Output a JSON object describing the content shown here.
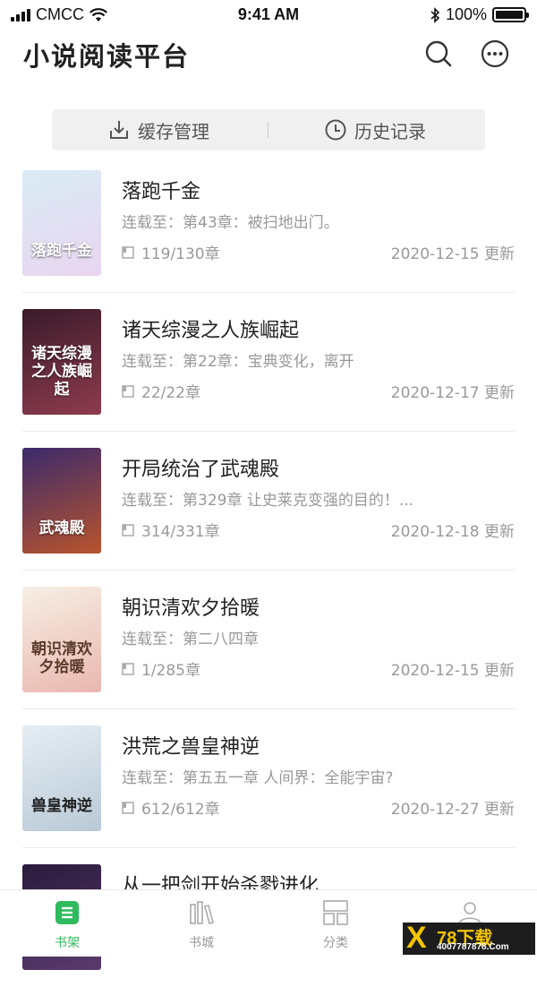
{
  "status_bar": {
    "carrier": "CMCC",
    "time": "9:41 AM",
    "battery": "100%"
  },
  "header": {
    "title": "小说阅读平台",
    "search_icon": "search-icon",
    "more_icon": "more-icon"
  },
  "tabs": {
    "cache": "缓存管理",
    "history": "历史记录"
  },
  "books": [
    {
      "title": "落跑千金",
      "progress": "连载至：第43章：被扫地出门。",
      "chapters": "119/130章",
      "updated": "2020-12-15 更新",
      "cover_text": "落跑千金",
      "cover_colors": [
        "#d9ecf5",
        "#e9d5f0"
      ]
    },
    {
      "title": "诸天综漫之人族崛起",
      "progress": "连载至：第22章：宝典变化，离开",
      "chapters": "22/22章",
      "updated": "2020-12-17 更新",
      "cover_text": "诸天综漫之人族崛起",
      "cover_colors": [
        "#3a1b2a",
        "#8e3b4e"
      ]
    },
    {
      "title": "开局统治了武魂殿",
      "progress": "连载至：第329章 让史莱克变强的目的！...",
      "chapters": "314/331章",
      "updated": "2020-12-18 更新",
      "cover_text": "武魂殿",
      "cover_colors": [
        "#3b2a6b",
        "#b9542d"
      ]
    },
    {
      "title": "朝识清欢夕拾暖",
      "progress": "连载至：第二八四章",
      "chapters": "1/285章",
      "updated": "2020-12-15 更新",
      "cover_text": "朝识清欢夕拾暖",
      "cover_colors": [
        "#f7efe4",
        "#e9b7b0"
      ]
    },
    {
      "title": "洪荒之兽皇神逆",
      "progress": "连载至：第五五一章 人间界：全能宇宙?",
      "chapters": "612/612章",
      "updated": "2020-12-27 更新",
      "cover_text": "兽皇神逆",
      "cover_colors": [
        "#e6eef4",
        "#b9c9d6"
      ]
    },
    {
      "title": "从一把剑开始杀戮进化",
      "progress": "",
      "chapters": "",
      "updated": "",
      "cover_text": "",
      "cover_colors": [
        "#2a1b3c",
        "#5a3a6e"
      ]
    }
  ],
  "tabbar": {
    "shelf": "书架",
    "store": "书城",
    "category": "分类",
    "mine": ""
  },
  "watermark": {
    "x": "X",
    "main": "78下载",
    "sub": "4007787878.Com"
  },
  "colors": {
    "accent": "#2fba5d",
    "muted": "#999999",
    "title": "#222222"
  }
}
